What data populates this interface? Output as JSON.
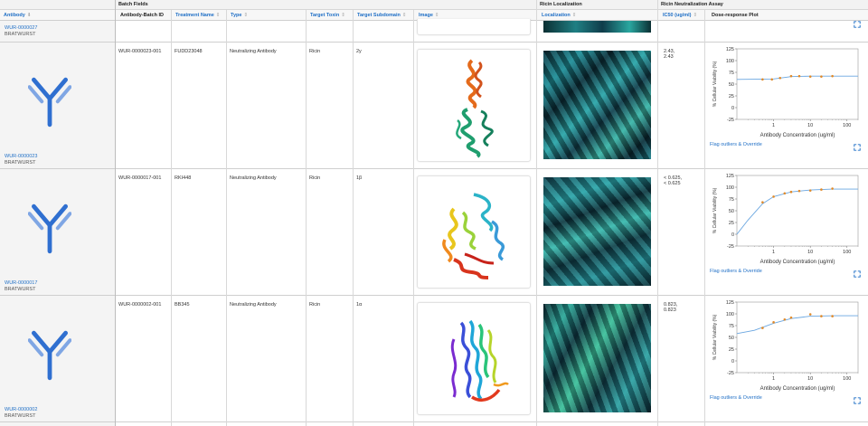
{
  "header": {
    "groups": {
      "batch": "Batch Fields",
      "localization": "Ricin Localization",
      "assay": "Ricin Neutralization Assay"
    },
    "columns": {
      "antibody": "Antibody",
      "batch_id": "Antibody-Batch ID",
      "treatment": "Treatment Name",
      "type": "Type",
      "toxin": "Target Toxin",
      "subdomain": "Target Subdomain",
      "image": "Image",
      "localization": "Localization",
      "ic50": "IC50 (ug/ml)",
      "dose": "Dose-response Plot"
    }
  },
  "partial_row": {
    "antibody_id": "WUR-0000027",
    "project": "BRATWURST"
  },
  "rows": [
    {
      "antibody_id": "WUR-0000023",
      "project": "BRATWURST",
      "batch_id": "WUR-0000023-001",
      "treatment": "FUDD23048",
      "type": "Neutralizing Antibody",
      "toxin": "Ricin",
      "subdomain": "2y",
      "ic50_line1": "2.43,",
      "ic50_line2": "2.43",
      "flag_link": "Flag outliers & Override"
    },
    {
      "antibody_id": "WUR-0000017",
      "project": "BRATWURST",
      "batch_id": "WUR-0000017-001",
      "treatment": "RKI448",
      "type": "Neutralizing Antibody",
      "toxin": "Ricin",
      "subdomain": "1β",
      "ic50_line1": "< 0.625,",
      "ic50_line2": "< 0.625",
      "flag_link": "Flag outliers & Override"
    },
    {
      "antibody_id": "WUR-0000002",
      "project": "BRATWURST",
      "batch_id": "WUR-0000002-001",
      "treatment": "BB345",
      "type": "Neutralizing Antibody",
      "toxin": "Ricin",
      "subdomain": "1α",
      "ic50_line1": "0.823,",
      "ic50_line2": "0.823",
      "flag_link": "Flag outliers & Override"
    }
  ],
  "chart_data": [
    {
      "type": "scatter",
      "xlabel": "Antibody Concentration (ug/ml)",
      "ylabel": "% Cellular Viability (%)",
      "x_scale": "log",
      "xlim": [
        0.1,
        200
      ],
      "ylim": [
        -25,
        125
      ],
      "y_ticks": [
        -25,
        0,
        25,
        50,
        75,
        100,
        125
      ],
      "x_ticks": [
        "1",
        "10",
        "100"
      ],
      "points": [
        [
          0.5,
          60
        ],
        [
          0.9,
          60
        ],
        [
          1.5,
          63
        ],
        [
          3,
          67
        ],
        [
          5,
          67
        ],
        [
          10,
          66
        ],
        [
          20,
          66
        ],
        [
          40,
          67
        ]
      ],
      "fit": [
        [
          0.1,
          60
        ],
        [
          1,
          61
        ],
        [
          3,
          66
        ],
        [
          10,
          67
        ],
        [
          200,
          67
        ]
      ]
    },
    {
      "type": "scatter",
      "xlabel": "Antibody Concentration (ug/ml)",
      "ylabel": "% Cellular Viability (%)",
      "x_scale": "log",
      "xlim": [
        0.1,
        200
      ],
      "ylim": [
        -25,
        125
      ],
      "y_ticks": [
        -25,
        0,
        25,
        50,
        75,
        100,
        125
      ],
      "x_ticks": [
        "1",
        "10",
        "100"
      ],
      "points": [
        [
          0.5,
          68
        ],
        [
          1,
          80
        ],
        [
          2,
          87
        ],
        [
          3,
          90
        ],
        [
          5,
          92
        ],
        [
          10,
          93
        ],
        [
          20,
          95
        ],
        [
          40,
          97
        ]
      ],
      "fit": [
        [
          0.1,
          0
        ],
        [
          0.2,
          30
        ],
        [
          0.5,
          65
        ],
        [
          1,
          80
        ],
        [
          3,
          90
        ],
        [
          10,
          94
        ],
        [
          40,
          96
        ],
        [
          200,
          96
        ]
      ]
    },
    {
      "type": "scatter",
      "xlabel": "Antibody Concentration (ug/ml)",
      "ylabel": "% Cellular Viability (%)",
      "x_scale": "log",
      "xlim": [
        0.1,
        200
      ],
      "ylim": [
        -25,
        125
      ],
      "y_ticks": [
        -25,
        0,
        25,
        50,
        75,
        100,
        125
      ],
      "x_ticks": [
        "1",
        "10",
        "100"
      ],
      "points": [
        [
          0.5,
          70
        ],
        [
          1,
          82
        ],
        [
          2,
          88
        ],
        [
          3,
          92
        ],
        [
          10,
          99
        ],
        [
          20,
          95
        ],
        [
          40,
          95
        ]
      ],
      "fit": [
        [
          0.1,
          58
        ],
        [
          0.3,
          65
        ],
        [
          1,
          80
        ],
        [
          3,
          90
        ],
        [
          10,
          95
        ],
        [
          50,
          96
        ],
        [
          200,
          96
        ]
      ]
    }
  ],
  "colors": {
    "link": "#1f6fc6",
    "fit_line": "#6aa6e0",
    "point": "#e08a2a",
    "antibody_dark": "#2f6fd0",
    "antibody_light": "#7fa6e4"
  }
}
